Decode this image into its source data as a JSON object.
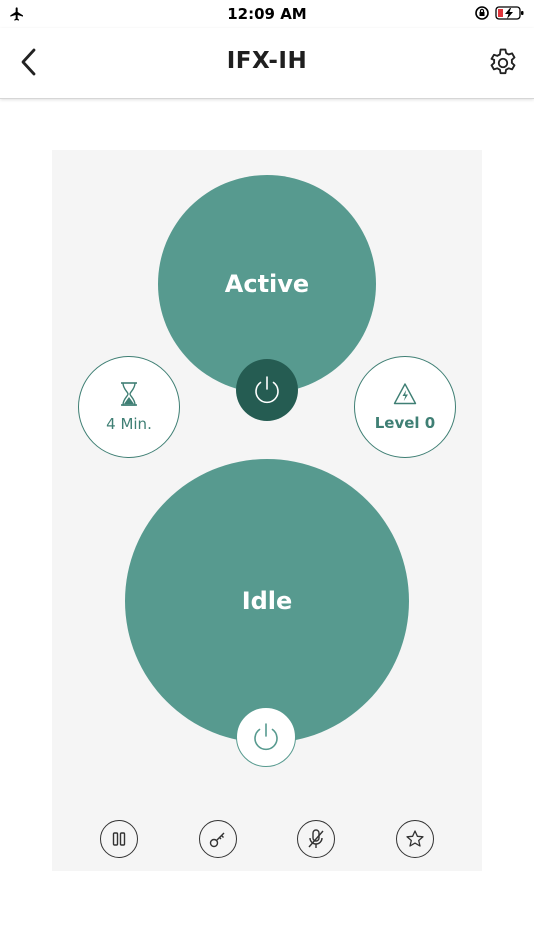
{
  "status_bar": {
    "time": "12:09 AM",
    "icons": [
      "airplane-icon",
      "orientation-lock-icon",
      "battery-charging-icon"
    ]
  },
  "nav": {
    "title": "IFX-IH",
    "back_icon": "chevron-left-icon",
    "settings_icon": "gear-icon"
  },
  "zones": {
    "top": {
      "label": "Active",
      "power_icon": "power-icon"
    },
    "bottom": {
      "label": "Idle",
      "power_icon": "power-icon"
    }
  },
  "controls": {
    "timer": {
      "label": "4 Min.",
      "icon": "hourglass-icon"
    },
    "level": {
      "label": "Level 0",
      "icon": "power-level-icon"
    }
  },
  "bottom_bar": {
    "icons": [
      "pause-icon",
      "key-icon",
      "mute-mic-icon",
      "star-icon"
    ]
  },
  "colors": {
    "accent": "#579a8f",
    "accent_dark": "#255c52",
    "panel_bg": "#f5f5f5"
  }
}
